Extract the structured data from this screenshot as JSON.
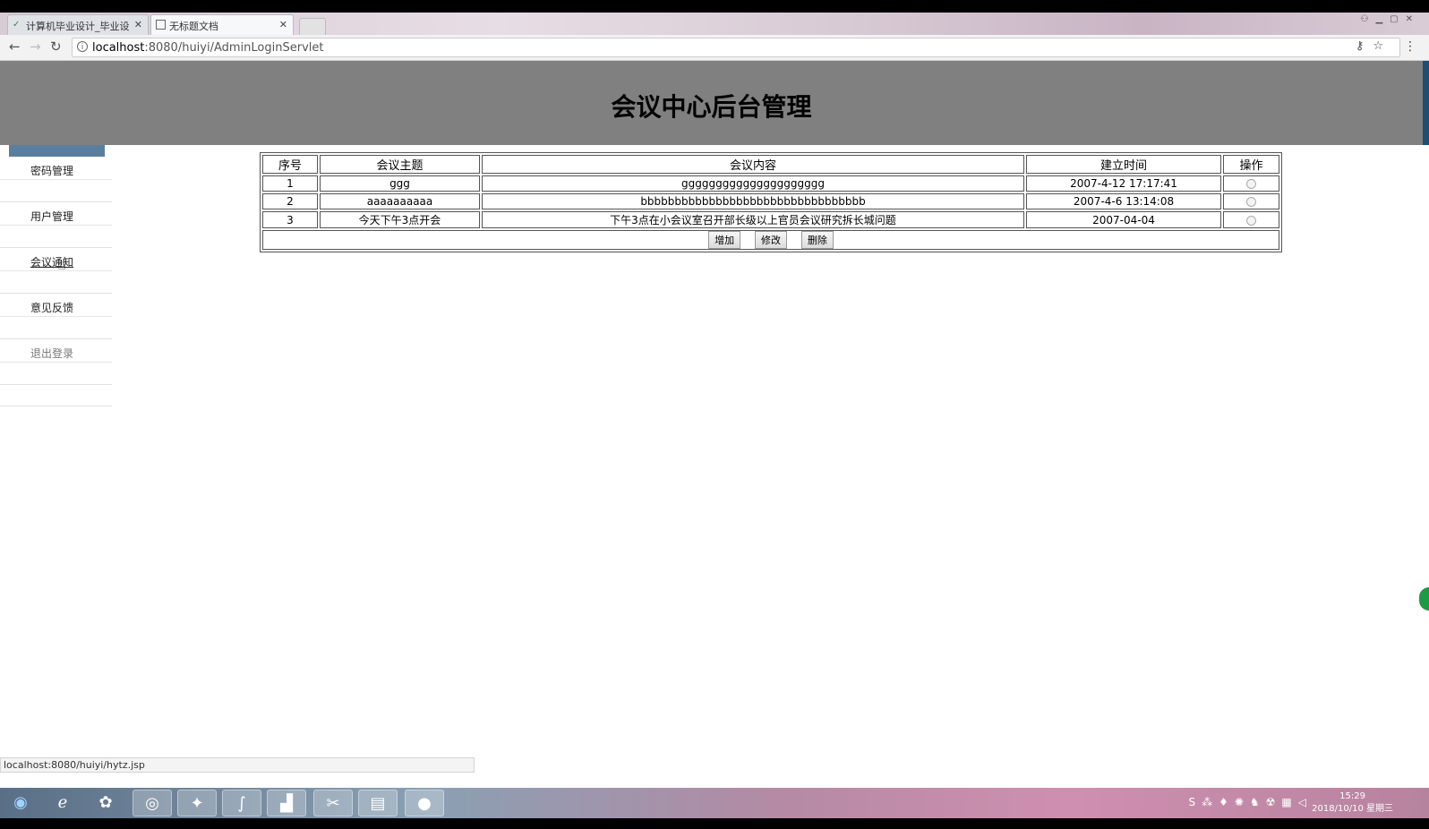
{
  "browser": {
    "tabs": [
      {
        "title": "计算机毕业设计_毕业设",
        "favicon": "green-logo-icon"
      },
      {
        "title": "无标题文档",
        "favicon": "doc-icon"
      }
    ],
    "close_glyph": "✕",
    "url_host": "localhost",
    "url_path": ":8080/huiyi/AdminLoginServlet"
  },
  "page": {
    "title": "会议中心后台管理",
    "sidebar": [
      {
        "label": "密码管理"
      },
      {
        "label": "用户管理"
      },
      {
        "label": "会议通知"
      },
      {
        "label": "意见反馈"
      },
      {
        "label": "退出登录"
      }
    ],
    "table": {
      "headers": [
        "序号",
        "会议主题",
        "会议内容",
        "建立时间",
        "操作"
      ],
      "rows": [
        {
          "id": "1",
          "topic": "ggg",
          "content": "ggggggggggggggggggggg",
          "time": "2007-4-12 17:17:41"
        },
        {
          "id": "2",
          "topic": "aaaaaaaaaa",
          "content": "bbbbbbbbbbbbbbbbbbbbbbbbbbbbbbbbb",
          "time": "2007-4-6 13:14:08"
        },
        {
          "id": "3",
          "topic": "今天下午3点开会",
          "content": "下午3点在小会议室召开部长级以上官员会议研究拆长城问题",
          "time": "2007-04-04"
        }
      ],
      "buttons": {
        "add": "增加",
        "edit": "修改",
        "delete": "删除"
      }
    },
    "status_url": "localhost:8080/huiyi/hytz.jsp"
  },
  "taskbar": {
    "time": "15:29",
    "date": "2018/10/10 星期三"
  }
}
